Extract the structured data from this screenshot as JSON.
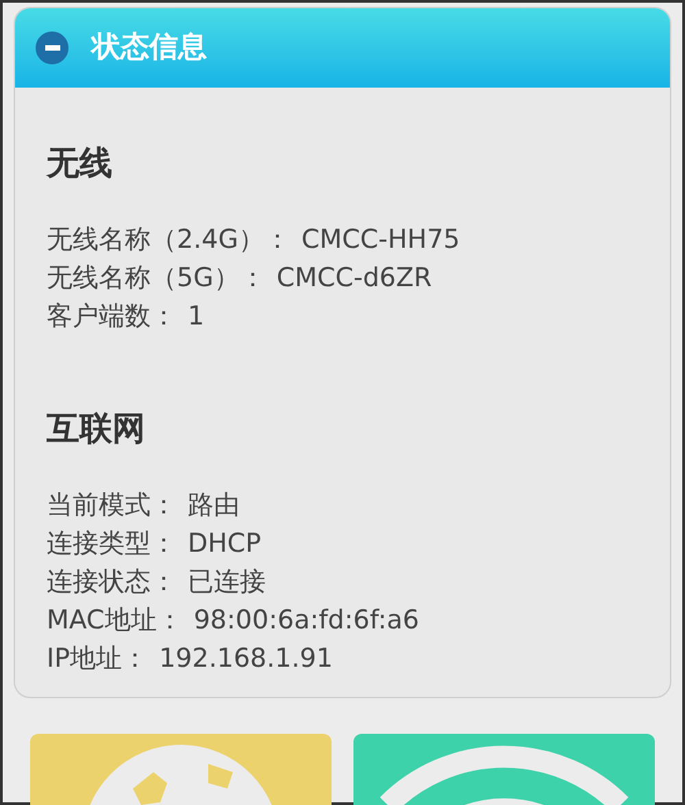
{
  "panel": {
    "title": "状态信息",
    "expanded": true
  },
  "sections": [
    {
      "title": "无线",
      "rows": [
        {
          "label": "无线名称（2.4G）：",
          "value": "CMCC-HH75"
        },
        {
          "label": "无线名称（5G）：",
          "value": "CMCC-d6ZR"
        },
        {
          "label": "客户端数：",
          "value": "1"
        }
      ]
    },
    {
      "title": "互联网",
      "rows": [
        {
          "label": "当前模式：",
          "value": "路由"
        },
        {
          "label": "连接类型：",
          "value": "DHCP"
        },
        {
          "label": "连接状态：",
          "value": "已连接"
        },
        {
          "label": "MAC地址：",
          "value": "98:00:6a:fd:6f:a6"
        },
        {
          "label": "IP地址：",
          "value": "192.168.1.91"
        }
      ]
    }
  ],
  "tiles": [
    {
      "kind": "globe"
    },
    {
      "kind": "wifi"
    }
  ]
}
